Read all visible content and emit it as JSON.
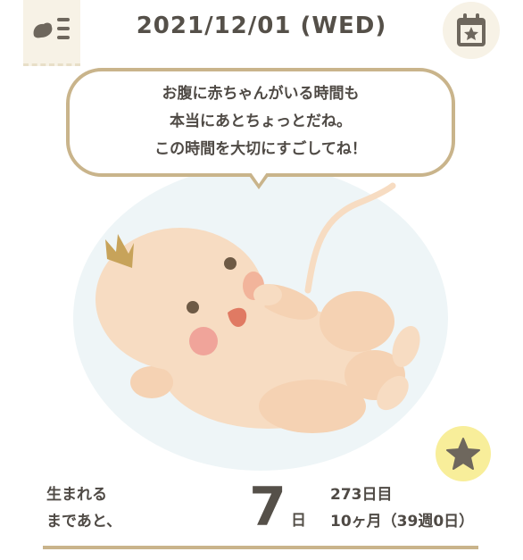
{
  "header": {
    "date": "2021/12/01 (WED)",
    "menu_icon": "baby-menu-icon",
    "calendar_icon": "calendar-star-icon"
  },
  "message": {
    "line1": "お腹に赤ちゃんがいる時間も",
    "line2": "本当にあとちょっとだね。",
    "line3": "この時間を大切にすごしてね！"
  },
  "illustration": "baby-in-womb",
  "favorite_icon": "star-icon",
  "countdown": {
    "label_line1": "生まれる",
    "label_line2": "まであと、",
    "days": "7",
    "unit": "日",
    "day_of_pregnancy": "273日目",
    "month_week": "10ヶ月（39週0日）"
  },
  "colors": {
    "accent_gold": "#c9b48b",
    "text_dark": "#555049",
    "star_button_bg": "#f8ee9a",
    "tab_bg": "#f7f2e6"
  }
}
